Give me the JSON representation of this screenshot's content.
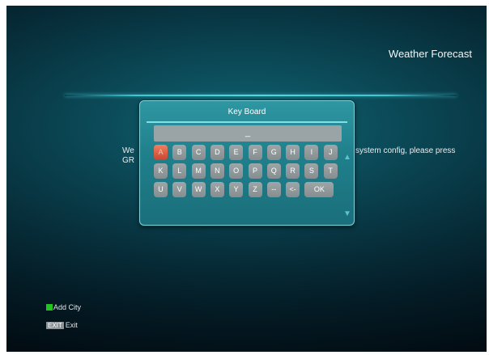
{
  "header": {
    "title": "Weather Forecast"
  },
  "message": {
    "left_line1": "We",
    "left_line2": "GR",
    "right_line1": "system config, please press"
  },
  "keyboard": {
    "title": "Key Board",
    "input_value": "_",
    "selected_key": "A",
    "rows": [
      [
        "A",
        "B",
        "C",
        "D",
        "E",
        "F",
        "G",
        "H",
        "I",
        "J"
      ],
      [
        "K",
        "L",
        "M",
        "N",
        "O",
        "P",
        "Q",
        "R",
        "S",
        "T"
      ],
      [
        "U",
        "V",
        "W",
        "X",
        "Y",
        "Z",
        "--",
        "<-",
        "OK"
      ]
    ],
    "scroll_up_icon": "triangle-up-icon",
    "scroll_down_icon": "triangle-down-icon"
  },
  "footer": {
    "add_city": {
      "key": "green-button",
      "label": "Add City"
    },
    "exit": {
      "key": "EXIT",
      "label": "Exit"
    }
  },
  "colors": {
    "selected_key": "#e05a42",
    "key": "#8f979a",
    "green_button": "#22c422",
    "accent_line": "#3fc6d0"
  }
}
